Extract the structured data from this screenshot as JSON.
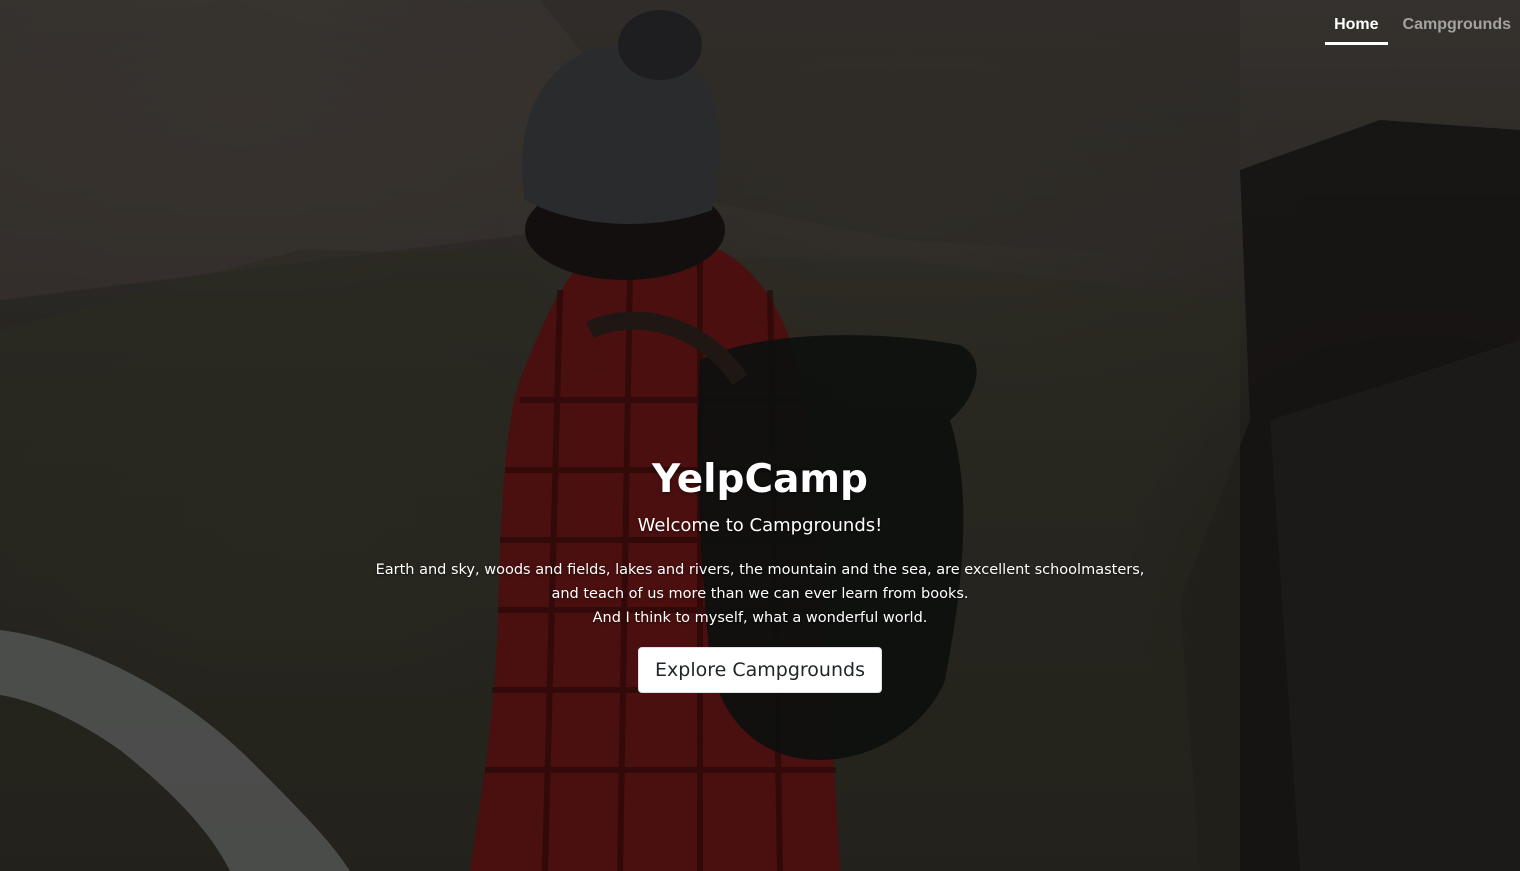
{
  "nav": {
    "items": [
      {
        "label": "Home",
        "active": true
      },
      {
        "label": "Campgrounds",
        "active": false
      }
    ]
  },
  "hero": {
    "title": "YelpCamp",
    "subtitle": "Welcome to Campgrounds!",
    "quote_lines": [
      "Earth and sky, woods and fields, lakes and rivers, the mountain and the sea, are excellent schoolmasters,",
      "and teach of us more than we can ever learn from books.",
      "And I think to myself, what a wonderful world."
    ],
    "button_label": "Explore Campgrounds"
  },
  "colors": {
    "text": "#ffffff",
    "nav_inactive": "rgba(255,255,255,0.55)",
    "button_bg": "#ffffff",
    "button_text": "#212529"
  }
}
